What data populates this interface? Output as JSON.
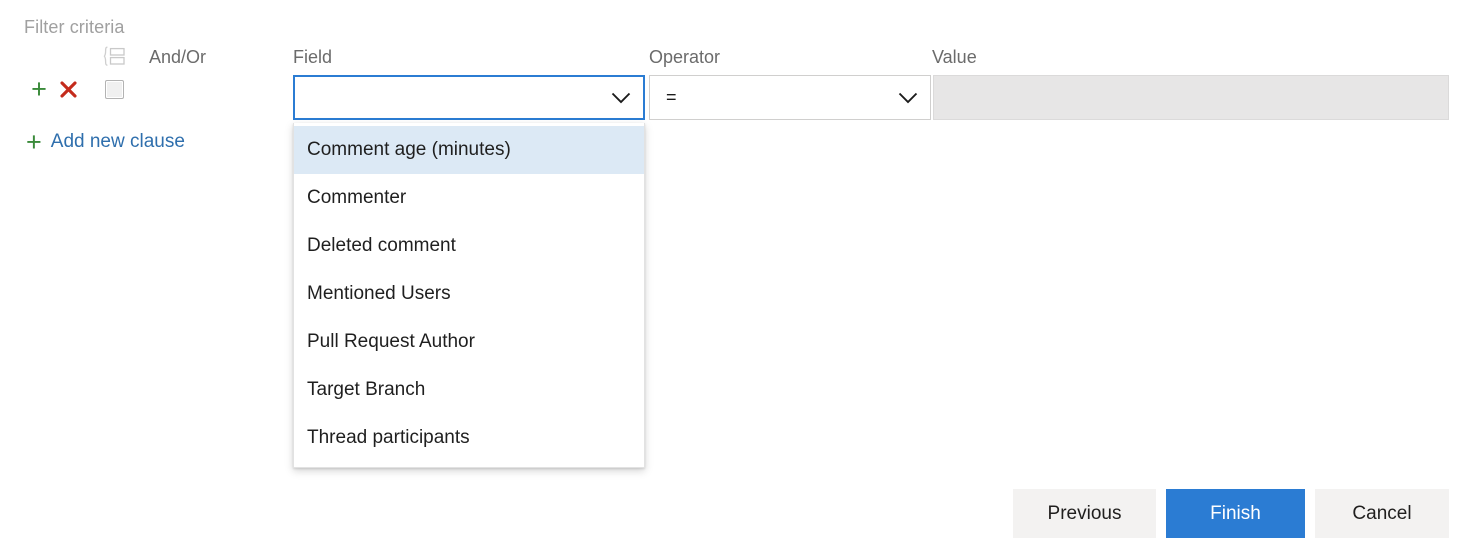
{
  "section": {
    "label": "Filter criteria"
  },
  "columns": {
    "andor": "And/Or",
    "field": "Field",
    "operator": "Operator",
    "value": "Value"
  },
  "icons": {
    "group": "group-clauses-icon",
    "add_clause_row": "plus-icon",
    "delete_clause_row": "close-icon",
    "add_new_clause": "plus-icon",
    "field_chevron": "chevron-down-icon",
    "operator_chevron": "chevron-down-icon",
    "plus_glyph": "+"
  },
  "clause_row": {
    "checkbox_checked": false,
    "field_value": "",
    "operator_value": "=",
    "value_value": "",
    "value_disabled": true
  },
  "add_clause": {
    "label": "Add new clause"
  },
  "field_dropdown": {
    "open": true,
    "selected_index": 0,
    "options": [
      "Comment age (minutes)",
      "Commenter",
      "Deleted comment",
      "Mentioned Users",
      "Pull Request Author",
      "Target Branch",
      "Thread participants"
    ]
  },
  "footer": {
    "previous_label": "Previous",
    "finish_label": "Finish",
    "cancel_label": "Cancel"
  },
  "colors": {
    "accent_blue": "#2b7cd3",
    "link_blue": "#2f6fad",
    "green": "#3a8a3a",
    "red": "#c42b1c",
    "highlight": "#dce9f5",
    "disabled_fill": "#e7e6e6",
    "button_neutral": "#f3f2f1",
    "label_gray": "#a0a0a0",
    "header_gray": "#6b6b6b"
  }
}
